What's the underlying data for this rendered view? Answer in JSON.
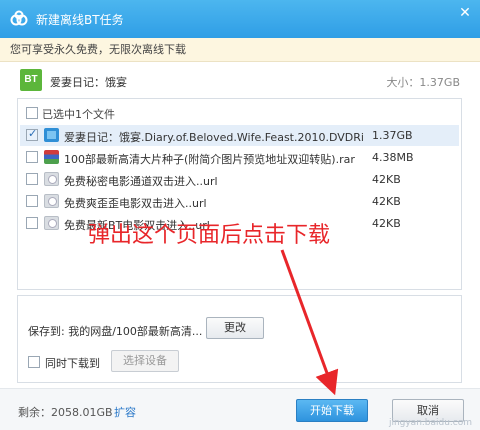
{
  "window": {
    "title": "新建离线BT任务",
    "close_glyph": "✕"
  },
  "notice": "您可享受永久免费，无限次离线下载",
  "task": {
    "badge": "BT",
    "name": "爱妻日记：饿宴",
    "size": "大小：1.37GB"
  },
  "file_list": {
    "header_label": "已选中1个文件",
    "rows": [
      {
        "name": "爱妻日记：饿宴.Diary.of.Beloved.Wife.Feast.2010.DVDRi...",
        "size": "1.37GB",
        "checked": true,
        "icon": "bt-file-icon"
      },
      {
        "name": "100部最新高清大片种子(附简介图片预览地址双迎转贴).rar",
        "size": "4.38MB",
        "checked": false,
        "icon": "rar-file-icon"
      },
      {
        "name": "免费秘密电影通道双击进入..url",
        "size": "42KB",
        "checked": false,
        "icon": "url-file-icon"
      },
      {
        "name": "免费爽歪歪电影双击进入..url",
        "size": "42KB",
        "checked": false,
        "icon": "url-file-icon"
      },
      {
        "name": "免费最新BT电影双击进入..url",
        "size": "42KB",
        "checked": false,
        "icon": "url-file-icon"
      }
    ]
  },
  "save": {
    "save_to": "保存到: 我的网盘/100部最新高清...",
    "change_label": "更改",
    "sync_label": "同时下载到",
    "select_device_label": "选择设备"
  },
  "footer": {
    "remaining": "剩余：2058.01GB",
    "expand": "扩容",
    "start_label": "开始下载",
    "cancel_label": "取消"
  },
  "annotation": {
    "text": "弹出这个页面后点击下载",
    "color": "#e8262a"
  },
  "watermark": "jingyan.baidu.com"
}
